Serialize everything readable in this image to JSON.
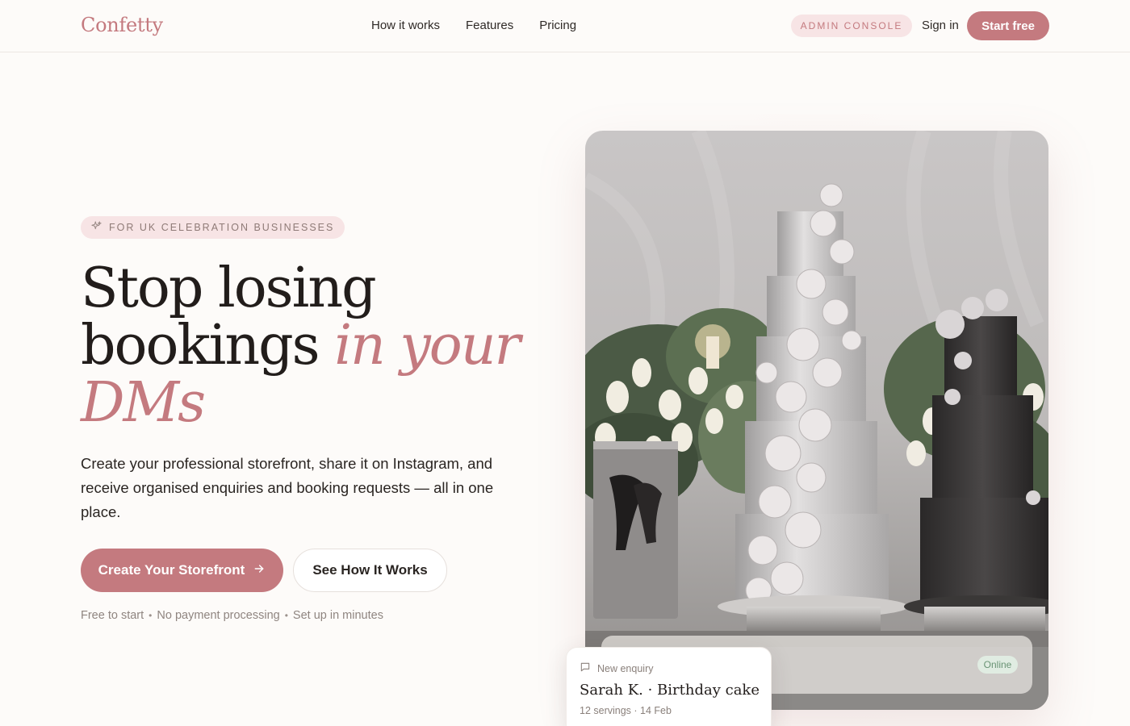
{
  "brand": {
    "logo": "Confetty"
  },
  "nav": {
    "links": [
      "How it works",
      "Features",
      "Pricing"
    ],
    "admin_label": "ADMIN CONSOLE",
    "signin_label": "Sign in",
    "start_label": "Start free"
  },
  "hero": {
    "eyebrow": "FOR UK CELEBRATION BUSINESSES",
    "headline_plain_1": "Stop losing",
    "headline_plain_2": "bookings ",
    "headline_accent_1": "in your",
    "headline_accent_2": "DMs",
    "description": "Create your professional storefront, share it on Instagram, and receive organised enquiries and booking requests — all in one place.",
    "cta_primary": "Create Your Storefront",
    "cta_secondary": "See How It Works",
    "perks": [
      "Free to start",
      "No payment processing",
      "Set up in minutes"
    ],
    "perk_separator": "•"
  },
  "preview": {
    "status": "Online",
    "enquiry": {
      "label": "New enquiry",
      "title": "Sarah K. · Birthday cake",
      "meta": "12 servings · 14 Feb"
    }
  },
  "icons": {
    "eyebrow": "sparkle-icon",
    "cta": "arrow-right-icon",
    "enquiry": "message-icon"
  },
  "colors": {
    "accent": "#c47a7f",
    "accent_soft": "#f7e4e5",
    "background": "#fdfbf9",
    "text": "#221d1b",
    "online": "#6a9475"
  }
}
